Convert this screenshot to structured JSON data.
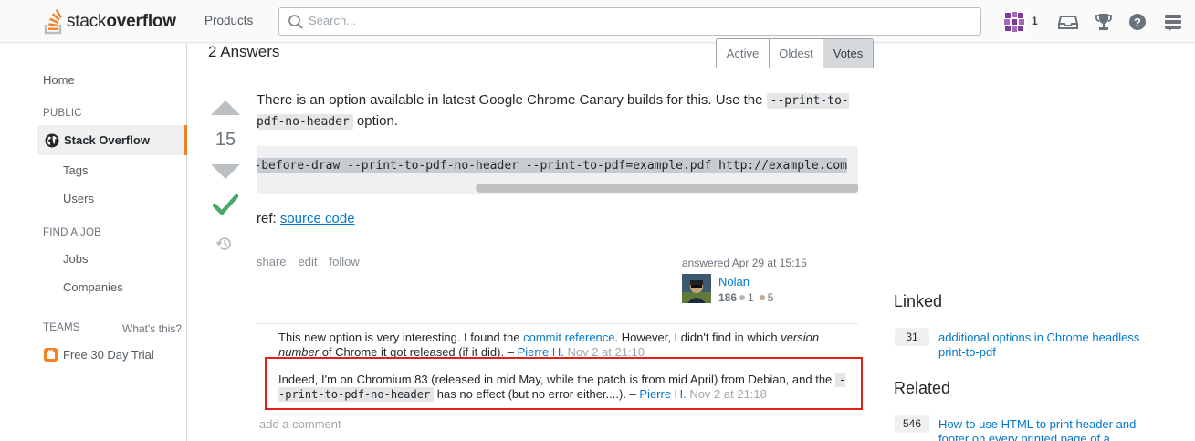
{
  "topbar": {
    "logo_text_light": "stack",
    "logo_text_bold": "overflow",
    "products": "Products",
    "search_placeholder": "Search...",
    "reputation": "1",
    "colors": {
      "accent": "#f48024",
      "link": "#0077cc"
    }
  },
  "leftnav": {
    "home": "Home",
    "public_head": "PUBLIC",
    "stack_overflow": "Stack Overflow",
    "tags": "Tags",
    "users": "Users",
    "find_job_head": "FIND A JOB",
    "jobs": "Jobs",
    "companies": "Companies",
    "teams_head": "TEAMS",
    "whats_this": "What's this?",
    "free_trial": "Free 30 Day Trial"
  },
  "main": {
    "answers_count": "2 Answers",
    "sort_tabs": [
      "Active",
      "Oldest",
      "Votes"
    ],
    "vote_count": "15",
    "post_text_1": "There is an option available in latest Google Chrome Canary builds for this. Use the ",
    "post_code_1": "--print-to-pdf-no-header",
    "post_text_2": " option.",
    "code_block": "--run-all-compositor-stages-before-draw --print-to-pdf-no-header --print-to-pdf=example.pdf http://example.com",
    "ref_label": "ref: ",
    "ref_link": "source code",
    "post_menu": [
      "share",
      "edit",
      "follow"
    ],
    "answered": "answered Apr 29 at 15:15",
    "user_name": "Nolan",
    "user_rep": "186",
    "silver_badges": "1",
    "bronze_badges": "5",
    "comments": [
      {
        "text_1": "This new option is very interesting. I found the ",
        "link_1": "commit reference",
        "text_2": ". However, I didn't find in which ",
        "em_1": "version number",
        "text_3": " of Chrome it got released (if it did). – ",
        "user": "Pierre H.",
        "date": "Nov 2 at 21:10"
      },
      {
        "text_1": "Indeed, I'm on Chromium 83 (released in mid May, while the patch is from mid April) from Debian, and the ",
        "code_1": "--print-to-pdf-no-header",
        "text_2": " has no effect (but no error either....). – ",
        "user": "Pierre H.",
        "date": "Nov 2 at 21:18"
      }
    ],
    "add_comment": "add a comment"
  },
  "sidebar": {
    "linked_head": "Linked",
    "linked": [
      {
        "count": "31",
        "title": "additional options in Chrome headless print-to-pdf"
      }
    ],
    "related_head": "Related",
    "related": [
      {
        "count": "546",
        "title": "How to use HTML to print header and footer on every printed page of a document?"
      }
    ]
  }
}
